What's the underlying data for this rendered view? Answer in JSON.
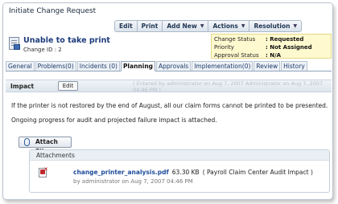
{
  "window": {
    "title": "Initiate Change Request"
  },
  "toolbar": {
    "items": [
      {
        "label": "Edit",
        "has_menu": false
      },
      {
        "label": "Print",
        "has_menu": false
      },
      {
        "label": "Add New",
        "has_menu": true
      },
      {
        "label": "Actions",
        "has_menu": true
      },
      {
        "label": "Resolution",
        "has_menu": true
      }
    ]
  },
  "header": {
    "title": "Unable to take print",
    "change_id": "Change ID : 2",
    "status": [
      {
        "key": "Change Status",
        "value": ": Requested"
      },
      {
        "key": "Priority",
        "value": ": Not Assigned"
      },
      {
        "key": "Approval Status",
        "value": ": N/A"
      }
    ]
  },
  "tabs": [
    {
      "label": "General",
      "active": false
    },
    {
      "label": "Problems(0)",
      "active": false
    },
    {
      "label": "Incidents (0)",
      "active": false
    },
    {
      "label": "Planning",
      "active": true
    },
    {
      "label": "Approvals",
      "active": false
    },
    {
      "label": "Implementation(0)",
      "active": false
    },
    {
      "label": "Review",
      "active": false
    },
    {
      "label": "History",
      "active": false
    }
  ],
  "impact": {
    "label": "Impact",
    "edit_label": "Edit",
    "entered_note": "( Entered by administrator on Aug 7, 2007  Administrator on Aug 7, 2007 04:46 PM )",
    "text1": "If the printer is not restored by the end of August, all our claim forms cannot be printed to be presented.",
    "text2": "Ongoing progress for audit and projected failure impact is attached."
  },
  "attach_button": {
    "label": "Attach File"
  },
  "attachments": {
    "heading": "Attachments",
    "items": [
      {
        "filename": "change_printer_analysis.pdf",
        "size": "63.30 KB",
        "description": "( Payroll Claim Center Audit Impact )",
        "byline": "by administrator on Aug 7, 2007 04:46 PM"
      }
    ]
  },
  "colors": {
    "accent": "#1d3c7c",
    "status_bg": "#fff9cf",
    "link": "#1f4d9b"
  }
}
